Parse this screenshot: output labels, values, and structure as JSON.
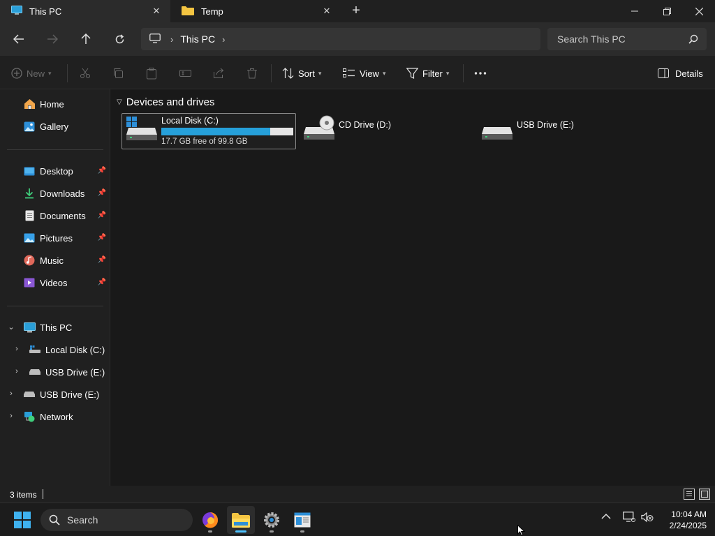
{
  "tabs": [
    {
      "label": "This PC",
      "icon": "monitor-icon",
      "active": true
    },
    {
      "label": "Temp",
      "icon": "folder-icon",
      "active": false
    }
  ],
  "window_controls": {
    "minimize": "minimize-icon",
    "restore": "restore-icon",
    "close": "close-icon"
  },
  "address_bar": {
    "breadcrumb": [
      "This PC"
    ],
    "search_placeholder": "Search This PC"
  },
  "command_bar": {
    "new_label": "New",
    "sort_label": "Sort",
    "view_label": "View",
    "filter_label": "Filter",
    "details_label": "Details"
  },
  "sidebar": {
    "quick": [
      {
        "label": "Home",
        "icon": "home-icon"
      },
      {
        "label": "Gallery",
        "icon": "gallery-icon"
      }
    ],
    "pinned": [
      {
        "label": "Desktop",
        "icon": "desktop-icon"
      },
      {
        "label": "Downloads",
        "icon": "download-icon"
      },
      {
        "label": "Documents",
        "icon": "document-icon"
      },
      {
        "label": "Pictures",
        "icon": "pictures-icon"
      },
      {
        "label": "Music",
        "icon": "music-icon"
      },
      {
        "label": "Videos",
        "icon": "video-icon"
      }
    ],
    "tree": [
      {
        "label": "This PC",
        "icon": "monitor-icon",
        "expanded": true
      },
      {
        "label": "Local Disk (C:)",
        "icon": "windows-drive-icon",
        "expanded": false
      },
      {
        "label": "USB Drive (E:)",
        "icon": "usb-drive-icon",
        "expanded": false
      },
      {
        "label": "USB Drive (E:)",
        "icon": "usb-drive-icon",
        "expanded": false
      },
      {
        "label": "Network",
        "icon": "network-icon",
        "expanded": false
      }
    ]
  },
  "main": {
    "group_title": "Devices and drives",
    "drives": [
      {
        "name": "Local Disk (C:)",
        "capacity_text": "17.7 GB free of 99.8 GB",
        "used_fraction": 0.823,
        "icon": "windows-drive-icon"
      },
      {
        "name": "CD Drive (D:)",
        "icon": "cd-drive-icon"
      },
      {
        "name": "USB Drive (E:)",
        "icon": "usb-drive-icon"
      }
    ]
  },
  "status_bar": {
    "item_count": "3 items"
  },
  "taskbar": {
    "search_label": "Search",
    "apps": [
      "firefox-icon",
      "file-explorer-icon",
      "settings-icon",
      "control-panel-icon"
    ],
    "time": "10:04 AM",
    "date": "2/24/2025"
  },
  "colors": {
    "accent": "#26a0da",
    "taskbar_active": "#4cc2ff",
    "folder": "#f4c542"
  }
}
